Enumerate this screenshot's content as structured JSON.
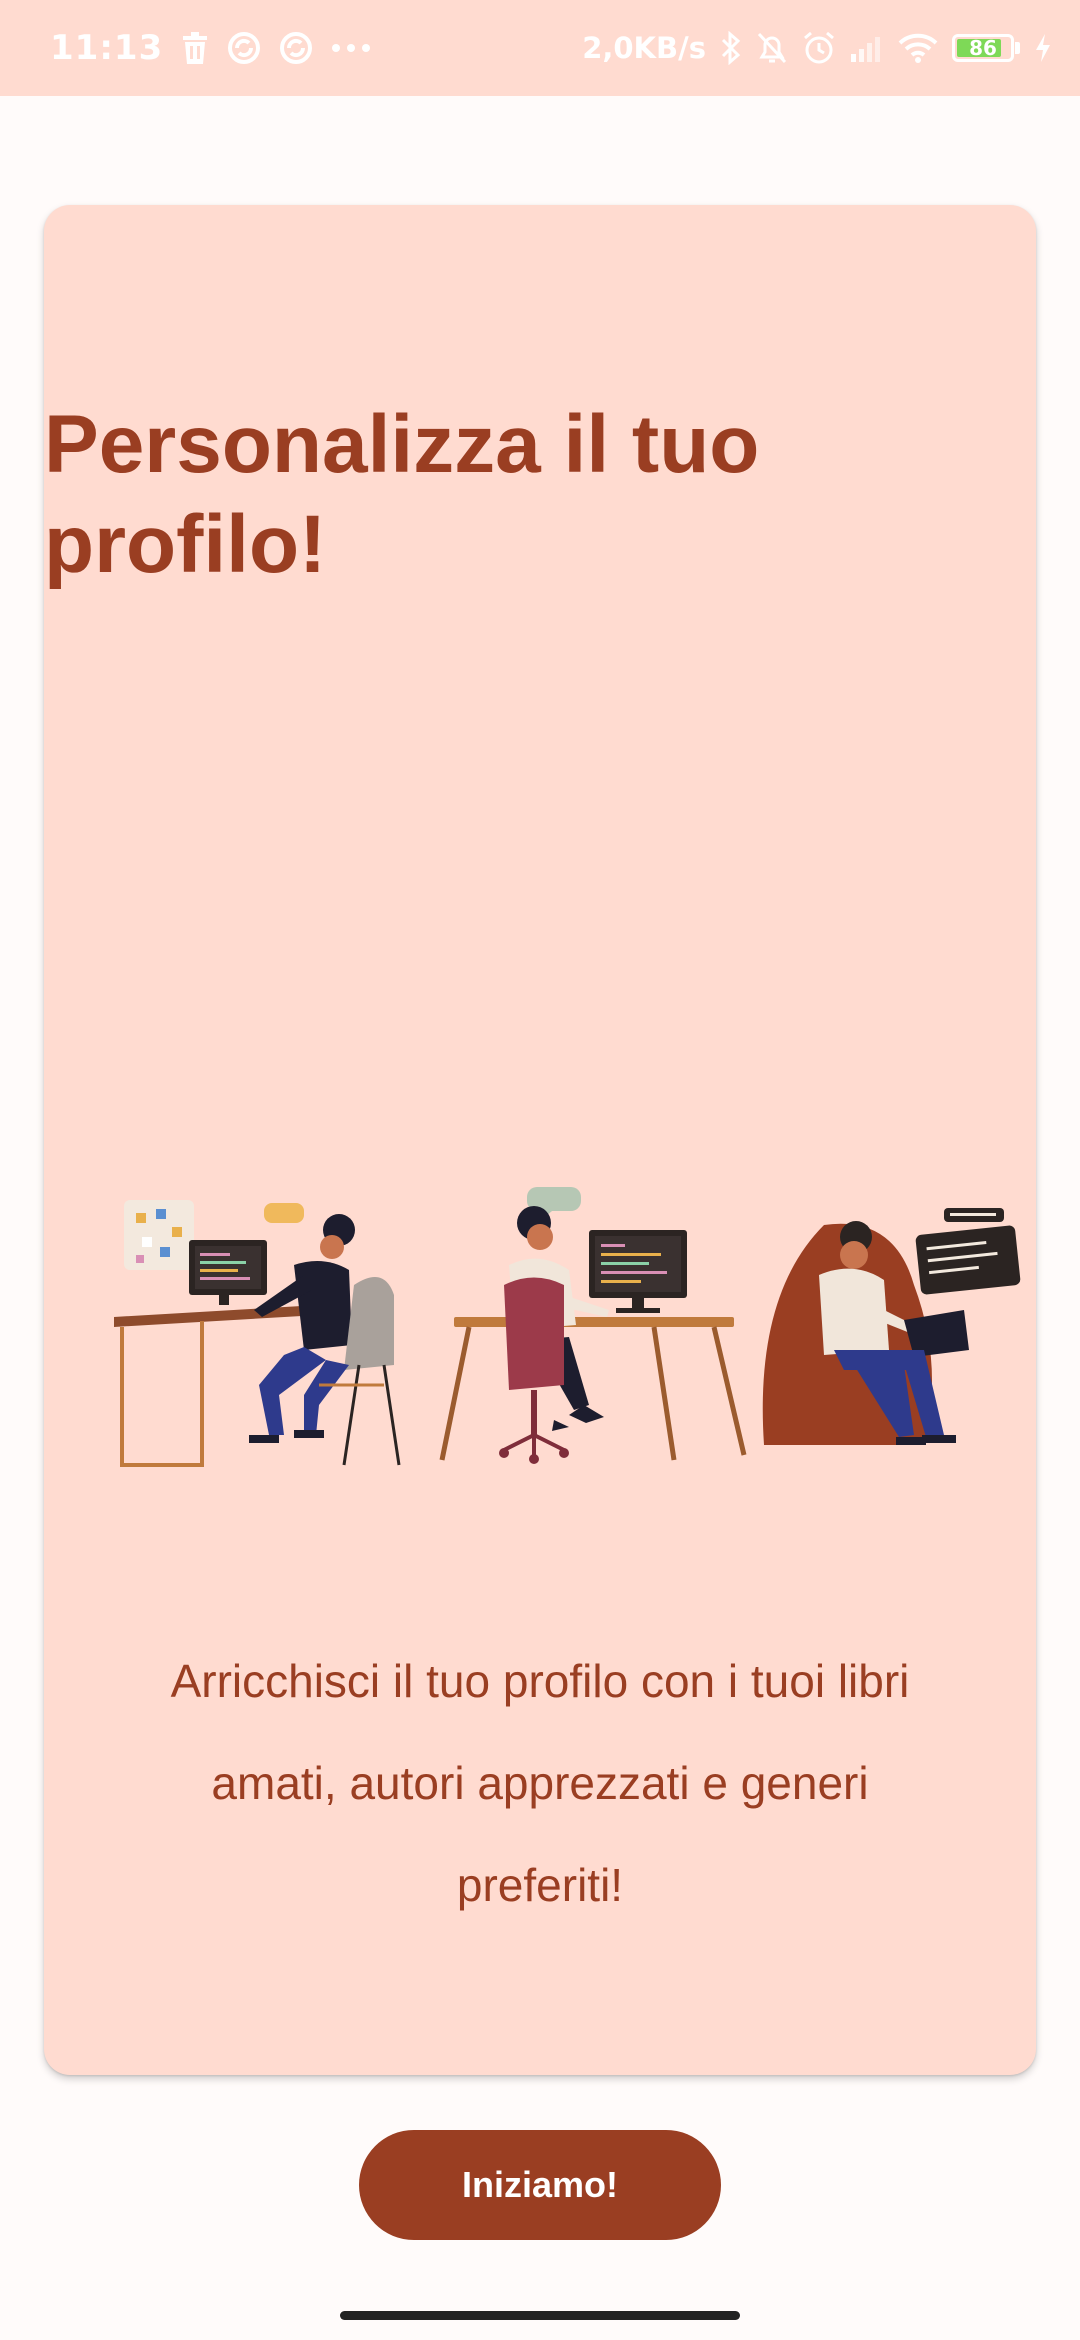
{
  "status_bar": {
    "time": "11:13",
    "network_speed": "2,0KB/s",
    "battery_level": "86",
    "battery_percent": 86,
    "left_icons": [
      "trash-icon",
      "sync-icon",
      "sync-icon",
      "more-dots-icon"
    ],
    "right_icons": [
      "bluetooth-icon",
      "bell-off-icon",
      "alarm-icon",
      "signal-icon",
      "wifi-icon",
      "battery-icon",
      "charging-icon"
    ]
  },
  "card": {
    "title": "Personalizza il tuo profilo!",
    "description": "Arricchisci il tuo profilo con i tuoi libri amati, autori apprezzati e generi preferiti!"
  },
  "cta": {
    "label": "Iniziamo!"
  },
  "colors": {
    "accent": "#9a3e22",
    "card_background": "#ffdbd0",
    "page_background": "#fffbfa",
    "status_bar": "#ffdbd0"
  }
}
